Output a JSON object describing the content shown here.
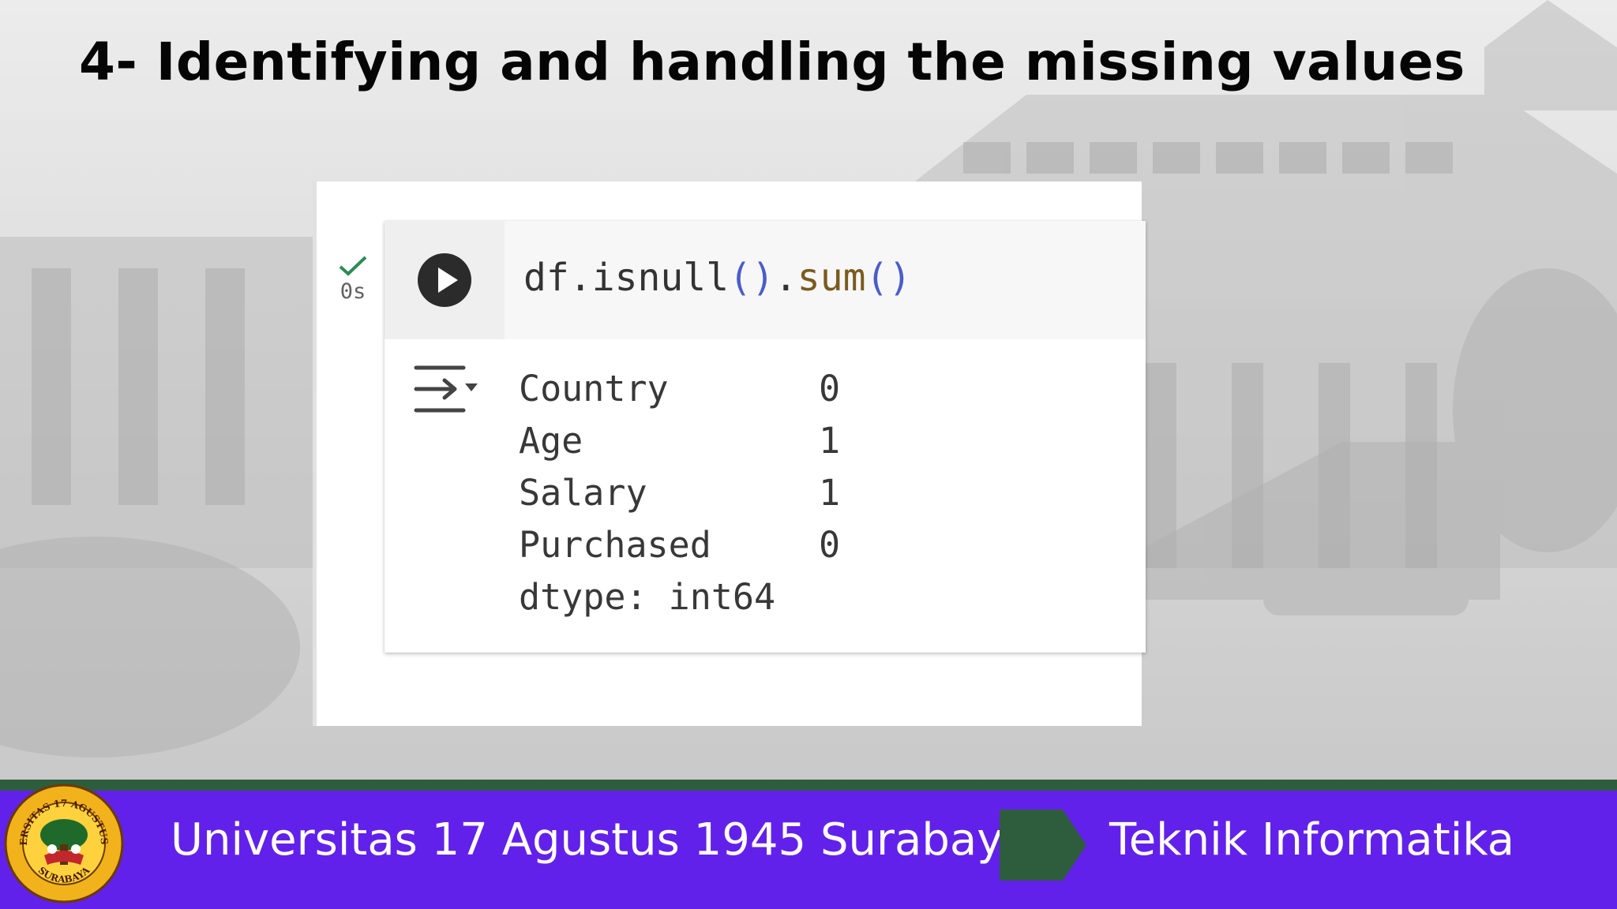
{
  "slide": {
    "title": "4- Identifying and handling the missing values"
  },
  "notebook_cell": {
    "execution_time": "0s",
    "code": {
      "obj": "df",
      "dot1": ".",
      "method1": "isnull",
      "parens1": "()",
      "dot2": ".",
      "method2": "sum",
      "parens2": "()"
    },
    "output": {
      "rows": [
        {
          "name": "Country",
          "value": "0"
        },
        {
          "name": "Age",
          "value": "1"
        },
        {
          "name": "Salary",
          "value": "1"
        },
        {
          "name": "Purchased",
          "value": "0"
        }
      ],
      "dtype_line": "dtype: int64"
    },
    "colors": {
      "code_text": "#333333",
      "paren": "#4a5dc9",
      "method": "#7a5a1e",
      "check": "#2e8b57"
    }
  },
  "footer": {
    "university": "Universitas 17 Agustus 1945 Surabaya",
    "department": "Teknik Informatika",
    "logo_text": "UNIVERSITAS 17 AGUSTUS 1945 SURABAYA",
    "colors": {
      "bar": "#6221ea",
      "accent": "#2e5d3e"
    }
  }
}
